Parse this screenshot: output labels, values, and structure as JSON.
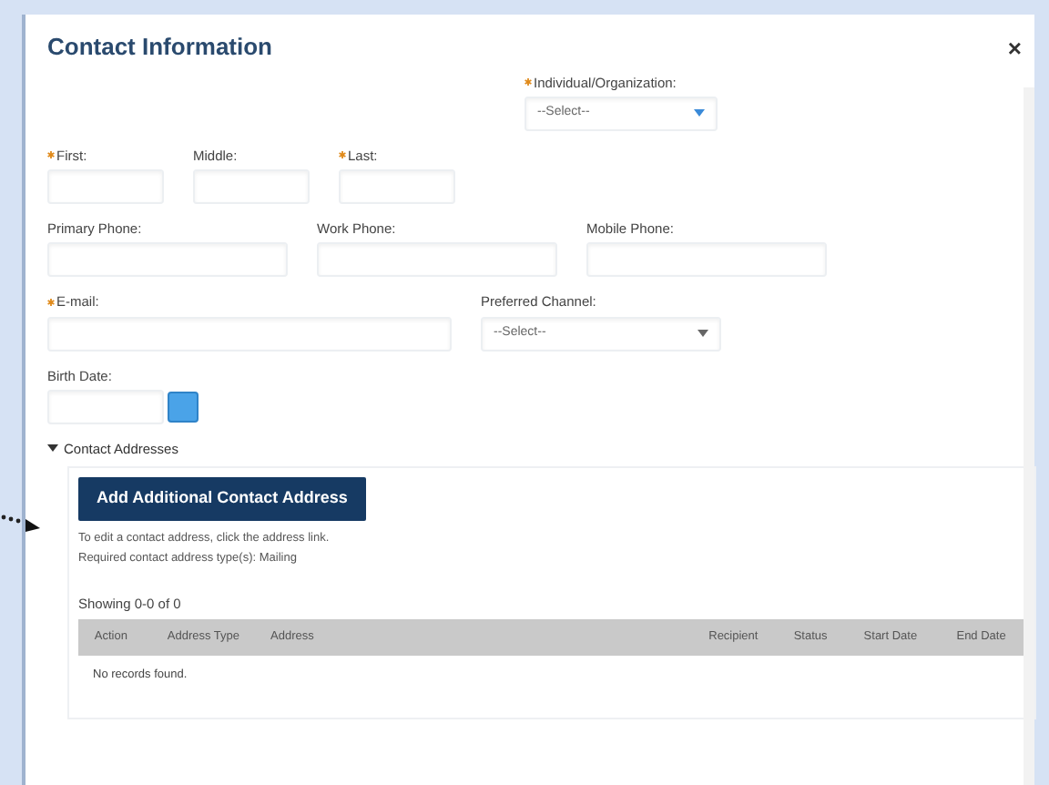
{
  "dialog": {
    "title": "Contact Information",
    "close": "×"
  },
  "field_rows": [
    {
      "fields": [
        {
          "label": "Individual/Organization:",
          "required": true,
          "kind": "select",
          "value": "--Select--"
        }
      ]
    },
    {
      "fields": [
        {
          "label": "First:",
          "required": true,
          "kind": "text"
        },
        {
          "label": "Middle:",
          "required": false,
          "kind": "text"
        },
        {
          "label": "Last:",
          "required": true,
          "kind": "text"
        }
      ]
    },
    {
      "fields": [
        {
          "label": "Primary Phone:",
          "required": false,
          "kind": "text"
        },
        {
          "label": "Work Phone:",
          "required": false,
          "kind": "text"
        },
        {
          "label": "Mobile Phone:",
          "required": false,
          "kind": "text"
        }
      ]
    },
    {
      "fields": [
        {
          "label": "E-mail:",
          "required": true,
          "kind": "text"
        },
        {
          "label": "Preferred Channel:",
          "required": false,
          "kind": "select",
          "value": "--Select--"
        }
      ]
    },
    {
      "fields": [
        {
          "label": "Birth Date:",
          "required": false,
          "kind": "date"
        }
      ]
    }
  ],
  "addresses": {
    "heading": "Contact Addresses",
    "expanded": true,
    "add_button": "Add Additional Contact Address",
    "notes": [
      "To edit a contact address, click the address link.",
      "Required contact address type(s): Mailing"
    ],
    "showing": "Showing 0-0 of 0",
    "columns": [
      "Action",
      "Address Type",
      "Address",
      "Recipient",
      "Status",
      "Start Date",
      "End Date"
    ],
    "empty": "No records found."
  }
}
